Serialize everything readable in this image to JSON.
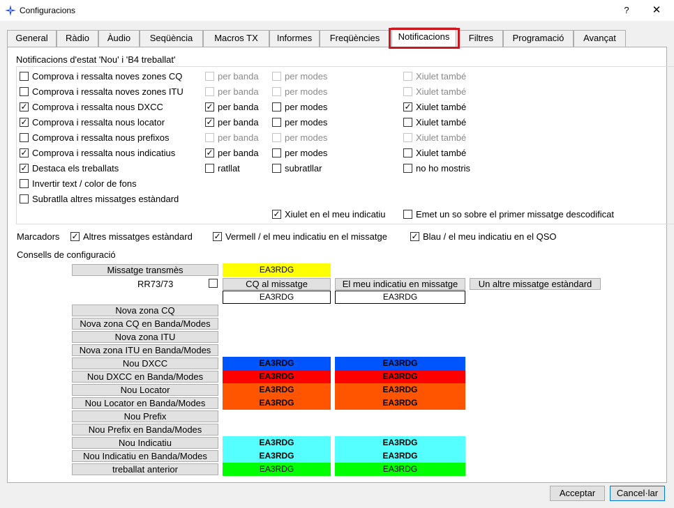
{
  "window": {
    "title": "Configuracions",
    "help_glyph": "?",
    "close_glyph": "✕"
  },
  "tabs": [
    {
      "label": "General",
      "active": false
    },
    {
      "label": "Ràdio",
      "active": false
    },
    {
      "label": "Àudio",
      "active": false
    },
    {
      "label": "Seqüència",
      "active": false
    },
    {
      "label": "Macros TX",
      "active": false
    },
    {
      "label": "Informes",
      "active": false
    },
    {
      "label": "Freqüències",
      "active": false
    },
    {
      "label": "Notificacions",
      "active": true
    },
    {
      "label": "Filtres",
      "active": false
    },
    {
      "label": "Programació",
      "active": false
    },
    {
      "label": "Avançat",
      "active": false
    }
  ],
  "notif_group": {
    "title": "Notificacions d'estat 'Nou' i 'B4 treballat'",
    "rows": [
      {
        "label": "Comprova i ressalta noves zones CQ",
        "checked": false,
        "band": "per banda",
        "band_checked": false,
        "band_enabled": false,
        "modes": "per modes",
        "modes_checked": false,
        "modes_enabled": false,
        "whistle": "Xiulet també",
        "whistle_checked": false,
        "whistle_enabled": false
      },
      {
        "label": "Comprova i ressalta noves zones ITU",
        "checked": false,
        "band": "per banda",
        "band_checked": false,
        "band_enabled": false,
        "modes": "per modes",
        "modes_checked": false,
        "modes_enabled": false,
        "whistle": "Xiulet també",
        "whistle_checked": false,
        "whistle_enabled": false
      },
      {
        "label": "Comprova i ressalta nous DXCC",
        "checked": true,
        "band": "per banda",
        "band_checked": true,
        "band_enabled": true,
        "modes": "per modes",
        "modes_checked": false,
        "modes_enabled": true,
        "whistle": "Xiulet també",
        "whistle_checked": true,
        "whistle_enabled": true
      },
      {
        "label": "Comprova i ressalta nous locator",
        "checked": true,
        "band": "per banda",
        "band_checked": true,
        "band_enabled": true,
        "modes": "per modes",
        "modes_checked": false,
        "modes_enabled": true,
        "whistle": "Xiulet també",
        "whistle_checked": false,
        "whistle_enabled": true
      },
      {
        "label": "Comprova i ressalta nous prefixos",
        "checked": false,
        "band": "per banda",
        "band_checked": false,
        "band_enabled": false,
        "modes": "per modes",
        "modes_checked": false,
        "modes_enabled": false,
        "whistle": "Xiulet també",
        "whistle_checked": false,
        "whistle_enabled": false
      },
      {
        "label": "Comprova i ressalta nous indicatius",
        "checked": true,
        "band": "per banda",
        "band_checked": true,
        "band_enabled": true,
        "modes": "per modes",
        "modes_checked": false,
        "modes_enabled": true,
        "whistle": "Xiulet també",
        "whistle_checked": false,
        "whistle_enabled": true
      },
      {
        "label": "Destaca els treballats",
        "checked": true,
        "band": "ratllat",
        "band_checked": false,
        "band_enabled": true,
        "modes": "subratllar",
        "modes_checked": false,
        "modes_enabled": true,
        "whistle": "no ho mostris",
        "whistle_checked": false,
        "whistle_enabled": true
      }
    ],
    "invert": {
      "label": "Invertir text / color de fons",
      "checked": false
    },
    "underline": {
      "label": "Subratlla altres missatges estàndard",
      "checked": false
    },
    "whistle_mycall": {
      "label": "Xiulet en el meu indicatiu",
      "checked": true
    },
    "emit_sound": {
      "label": "Emet un so sobre el primer missatge descodificat",
      "checked": false
    }
  },
  "markers": {
    "label": "Marcadors",
    "items": [
      {
        "label": "Altres missatges estàndard",
        "checked": true
      },
      {
        "label": "Vermell / el meu indicatiu en el missatge",
        "checked": true
      },
      {
        "label": "Blau / el meu indicatiu en el QSO",
        "checked": true
      }
    ]
  },
  "tips": {
    "title": "Consells de configuració",
    "tx_button": "Missatge transmès",
    "tx_value": "EA3RDG",
    "rr73_label": "RR73/73",
    "rr73_checked": false,
    "col_buttons": [
      "CQ al missatge",
      "El meu indicatiu en missatge",
      "Un altre missatge estàndard"
    ],
    "row_values": [
      "EA3RDG",
      "EA3RDG"
    ],
    "items": [
      {
        "button": "Nova zona CQ",
        "cells": []
      },
      {
        "button": "Nova zona CQ en Banda/Modes",
        "cells": []
      },
      {
        "button": "Nova zona ITU",
        "cells": []
      },
      {
        "button": "Nova zona ITU en Banda/Modes",
        "cells": []
      },
      {
        "button": "Nou DXCC",
        "cells": [
          "EA3RDG",
          "EA3RDG"
        ],
        "color": "#0055ff",
        "bold": true
      },
      {
        "button": "Nou DXCC en Banda/Modes",
        "cells": [
          "EA3RDG",
          "EA3RDG"
        ],
        "color": "#ff0000",
        "bold": true
      },
      {
        "button": "Nou Locator",
        "cells": [
          "EA3RDG",
          "EA3RDG"
        ],
        "color": "#ff5500",
        "bold": true
      },
      {
        "button": "Nou Locator en Banda/Modes",
        "cells": [
          "EA3RDG",
          "EA3RDG"
        ],
        "color": "#ff5500",
        "bold": true
      },
      {
        "button": "Nou Prefix",
        "cells": []
      },
      {
        "button": "Nou Prefix en Banda/Modes",
        "cells": []
      },
      {
        "button": "Nou Indicatiu",
        "cells": [
          "EA3RDG",
          "EA3RDG"
        ],
        "color": "#55ffff",
        "bold": true
      },
      {
        "button": "Nou Indicatiu en Banda/Modes",
        "cells": [
          "EA3RDG",
          "EA3RDG"
        ],
        "color": "#55ffff",
        "bold": true
      },
      {
        "button": "treballat anterior",
        "cells": [
          "EA3RDG",
          "EA3RDG"
        ],
        "color": "#00ff00",
        "bold": false
      }
    ],
    "tx_color": "#ffff00"
  },
  "dialog": {
    "accept": "Acceptar",
    "cancel": "Cancel·lar"
  }
}
